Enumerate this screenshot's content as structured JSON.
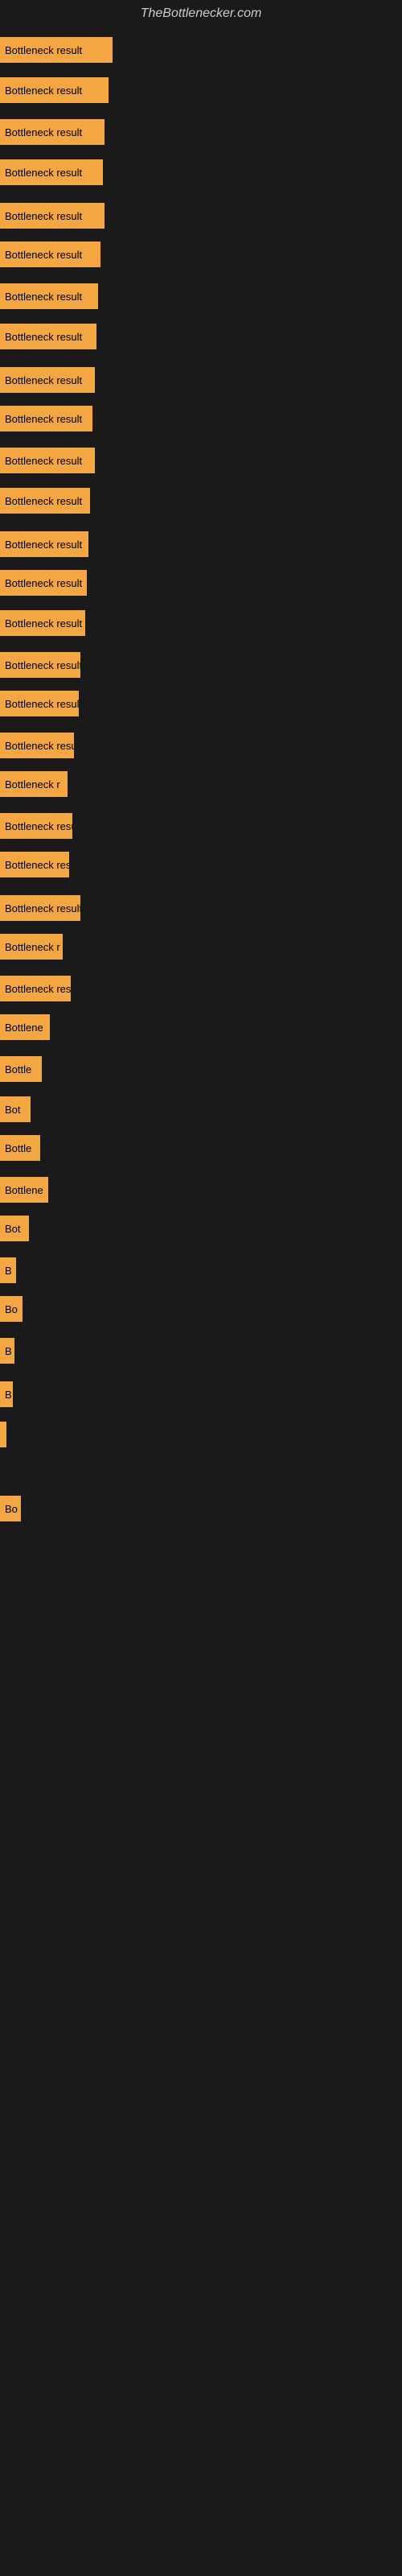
{
  "site": {
    "title": "TheBottlenecker.com"
  },
  "bars": [
    {
      "label": "Bottleneck result",
      "width": 140,
      "marginTop": 8
    },
    {
      "label": "Bottleneck result",
      "width": 135,
      "marginTop": 18
    },
    {
      "label": "Bottleneck result",
      "width": 130,
      "marginTop": 20
    },
    {
      "label": "Bottleneck result",
      "width": 128,
      "marginTop": 18
    },
    {
      "label": "Bottleneck result",
      "width": 130,
      "marginTop": 22
    },
    {
      "label": "Bottleneck result",
      "width": 125,
      "marginTop": 16
    },
    {
      "label": "Bottleneck result",
      "width": 122,
      "marginTop": 20
    },
    {
      "label": "Bottleneck result",
      "width": 120,
      "marginTop": 18
    },
    {
      "label": "Bottleneck result",
      "width": 118,
      "marginTop": 22
    },
    {
      "label": "Bottleneck result",
      "width": 115,
      "marginTop": 16
    },
    {
      "label": "Bottleneck result",
      "width": 118,
      "marginTop": 20
    },
    {
      "label": "Bottleneck result",
      "width": 112,
      "marginTop": 18
    },
    {
      "label": "Bottleneck result",
      "width": 110,
      "marginTop": 22
    },
    {
      "label": "Bottleneck result",
      "width": 108,
      "marginTop": 16
    },
    {
      "label": "Bottleneck result",
      "width": 106,
      "marginTop": 18
    },
    {
      "label": "Bottleneck result",
      "width": 100,
      "marginTop": 20
    },
    {
      "label": "Bottleneck result",
      "width": 98,
      "marginTop": 16
    },
    {
      "label": "Bottleneck resu",
      "width": 92,
      "marginTop": 20
    },
    {
      "label": "Bottleneck r",
      "width": 84,
      "marginTop": 16
    },
    {
      "label": "Bottleneck resu",
      "width": 90,
      "marginTop": 20
    },
    {
      "label": "Bottleneck res",
      "width": 86,
      "marginTop": 16
    },
    {
      "label": "Bottleneck result",
      "width": 100,
      "marginTop": 22
    },
    {
      "label": "Bottleneck r",
      "width": 78,
      "marginTop": 16
    },
    {
      "label": "Bottleneck resu",
      "width": 88,
      "marginTop": 20
    },
    {
      "label": "Bottlene",
      "width": 62,
      "marginTop": 16
    },
    {
      "label": "Bottle",
      "width": 52,
      "marginTop": 20
    },
    {
      "label": "Bot",
      "width": 38,
      "marginTop": 18
    },
    {
      "label": "Bottle",
      "width": 50,
      "marginTop": 16
    },
    {
      "label": "Bottlene",
      "width": 60,
      "marginTop": 20
    },
    {
      "label": "Bot",
      "width": 36,
      "marginTop": 16
    },
    {
      "label": "B",
      "width": 20,
      "marginTop": 20
    },
    {
      "label": "Bo",
      "width": 28,
      "marginTop": 16
    },
    {
      "label": "B",
      "width": 18,
      "marginTop": 20
    },
    {
      "label": "B",
      "width": 16,
      "marginTop": 22
    },
    {
      "label": "",
      "width": 8,
      "marginTop": 18
    },
    {
      "label": "Bo",
      "width": 26,
      "marginTop": 60
    }
  ]
}
